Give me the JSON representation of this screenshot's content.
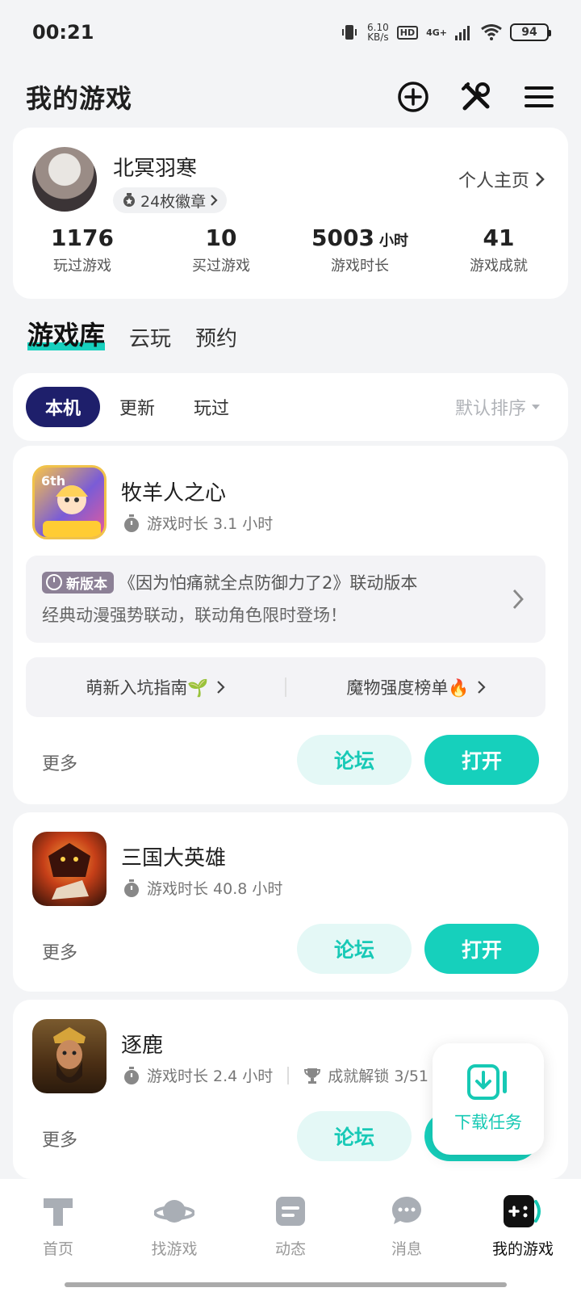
{
  "status_bar": {
    "time": "00:21",
    "net_speed_value": "6.10",
    "net_speed_unit": "KB/s",
    "hd": "HD",
    "signal": "4G+",
    "battery": "94"
  },
  "header": {
    "title": "我的游戏"
  },
  "profile": {
    "username": "北冥羽寒",
    "badges": "24枚徽章",
    "homepage_link": "个人主页",
    "stats": [
      {
        "value": "1176",
        "unit": "",
        "label": "玩过游戏"
      },
      {
        "value": "10",
        "unit": "",
        "label": "买过游戏"
      },
      {
        "value": "5003",
        "unit": "小时",
        "label": "游戏时长"
      },
      {
        "value": "41",
        "unit": "",
        "label": "游戏成就"
      }
    ]
  },
  "main_tabs": [
    "游戏库",
    "云玩",
    "预约"
  ],
  "filters": {
    "chips": [
      "本机",
      "更新",
      "玩过"
    ],
    "sort": "默认排序"
  },
  "games": [
    {
      "name": "牧羊人之心",
      "playtime": "游戏时长 3.1 小时",
      "promo": {
        "tag": "新版本",
        "title": "《因为怕痛就全点防御力了2》联动版本",
        "desc": "经典动漫强势联动，联动角色限时登场！"
      },
      "guides": [
        {
          "label": "萌新入坑指南🌱"
        },
        {
          "label": "魔物强度榜单🔥"
        }
      ],
      "more": "更多",
      "forum": "论坛",
      "open": "打开"
    },
    {
      "name": "三国大英雄",
      "playtime": "游戏时长 40.8 小时",
      "more": "更多",
      "forum": "论坛",
      "open": "打开"
    },
    {
      "name": "逐鹿",
      "playtime": "游戏时长 2.4 小时",
      "achievement": "成就解锁 3/51",
      "more": "更多",
      "forum": "论坛",
      "open": "打开"
    }
  ],
  "fab": {
    "label": "下载任务"
  },
  "bottom_nav": [
    {
      "label": "首页",
      "icon": "home-icon"
    },
    {
      "label": "找游戏",
      "icon": "planet-icon"
    },
    {
      "label": "动态",
      "icon": "feed-icon"
    },
    {
      "label": "消息",
      "icon": "chat-icon"
    },
    {
      "label": "我的游戏",
      "icon": "gamepad-icon"
    }
  ],
  "colors": {
    "accent": "#16d0bc",
    "dark_chip": "#1e1f6b",
    "background": "#f3f4f6"
  }
}
